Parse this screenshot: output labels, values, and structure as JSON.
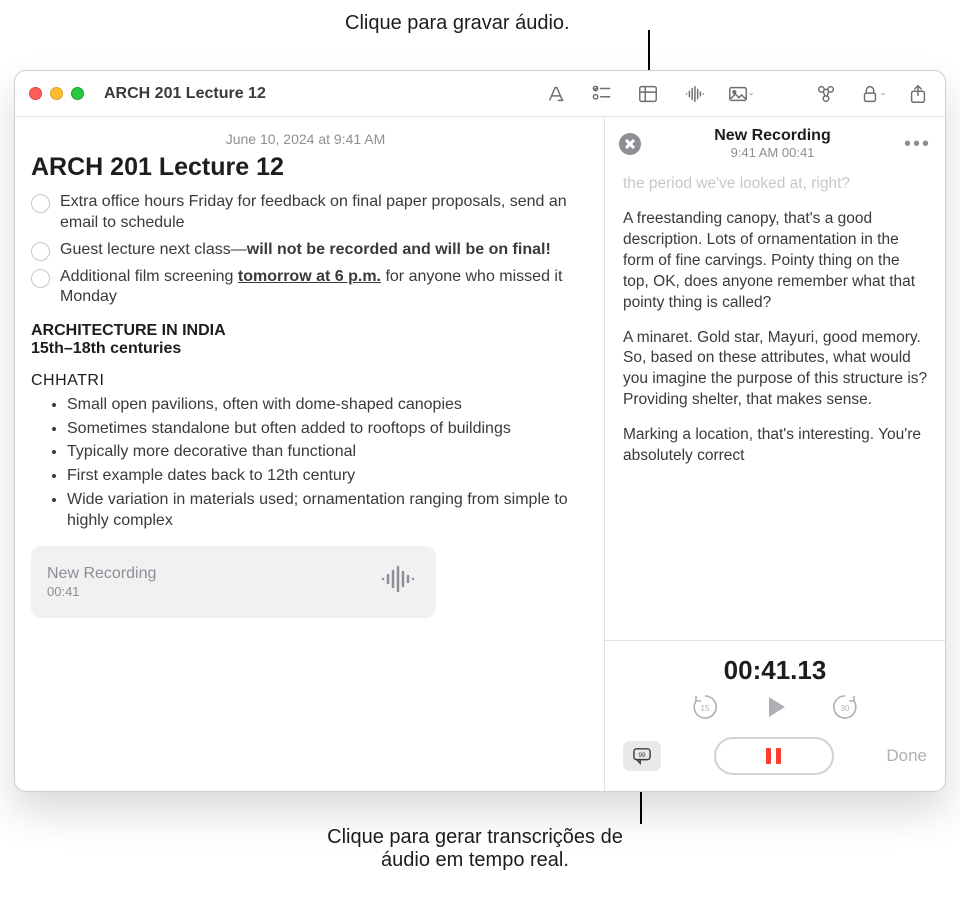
{
  "callouts": {
    "top": "Clique para gravar áudio.",
    "bottom_l1": "Clique para gerar transcrições de",
    "bottom_l2": "áudio em tempo real."
  },
  "window": {
    "title": "ARCH 201 Lecture 12"
  },
  "note": {
    "date": "June 10, 2024 at 9:41 AM",
    "title": "ARCH 201 Lecture 12",
    "check1": "Extra office hours Friday for feedback on final paper proposals, send an email to schedule",
    "check2_a": "Guest lecture next class—",
    "check2_b": "will not be recorded and will be on final!",
    "check3_a": "Additional film screening ",
    "check3_b": "tomorrow at 6 p.m.",
    "check3_c": " for anyone who missed it Monday",
    "section1": "ARCHITECTURE IN INDIA",
    "section1_sub": "15th–18th centuries",
    "section2": "CHHATRI",
    "bullets": [
      "Small open pavilions, often with dome-shaped canopies",
      "Sometimes standalone but often added to rooftops of buildings",
      "Typically more decorative than functional",
      "First example dates back to 12th century",
      "Wide variation in materials used; ornamentation ranging from simple to highly complex"
    ],
    "attachment": {
      "name": "New Recording",
      "duration": "00:41"
    }
  },
  "recording": {
    "title": "New Recording",
    "subtitle": "9:41 AM 00:41",
    "transcript_faded": "the period we've looked at, right?",
    "p1": "A freestanding canopy, that's a good description. Lots of ornamentation in the form of fine carvings. Pointy thing on the top, OK, does anyone remember what that pointy thing is called?",
    "p2": "A minaret. Gold star, Mayuri, good memory. So, based on these attributes, what would you imagine the purpose of this structure is? Providing shelter, that makes sense.",
    "p3": "Marking a location, that's interesting. You're absolutely correct",
    "big_time": "00:41.13",
    "skip_back": "15",
    "skip_fwd": "30",
    "done": "Done"
  }
}
